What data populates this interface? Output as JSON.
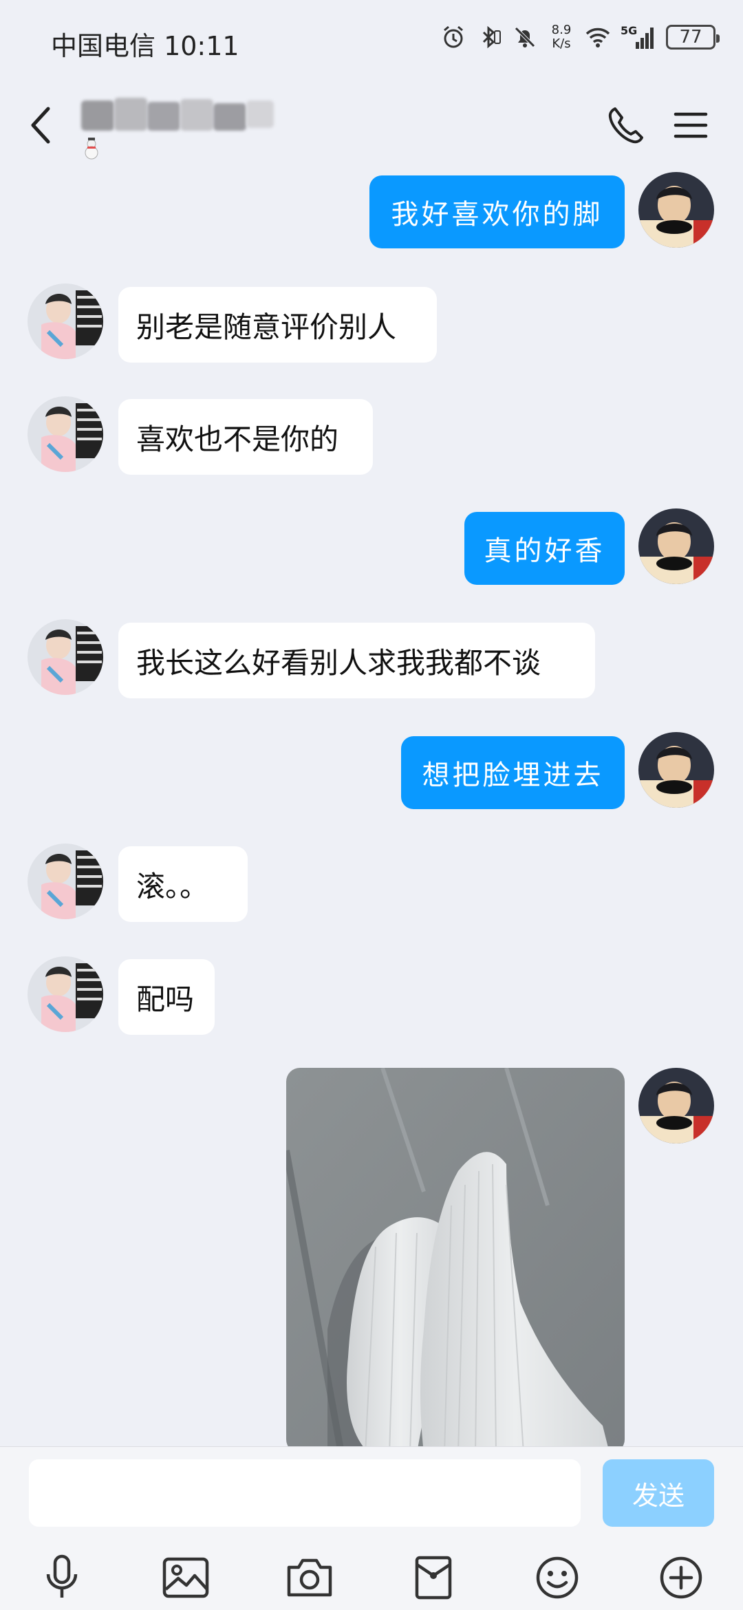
{
  "status_bar": {
    "carrier_time": "中国电信 10:11",
    "net_speed_value": "8.9",
    "net_speed_unit": "K/s",
    "network": "5G",
    "battery": "77"
  },
  "header": {
    "contact_name": "",
    "icons": [
      "back-arrow-icon",
      "phone-icon",
      "menu-icon"
    ]
  },
  "messages": [
    {
      "side": "out",
      "text": "我好喜欢你的脚"
    },
    {
      "side": "in",
      "text": "别老是随意评价别人"
    },
    {
      "side": "in",
      "text": "喜欢也不是你的"
    },
    {
      "side": "out",
      "text": "真的好香"
    },
    {
      "side": "in",
      "text": "我长这么好看别人求我我都不谈"
    },
    {
      "side": "out",
      "text": "想把脸埋进去"
    },
    {
      "side": "in",
      "text": "滚。。"
    },
    {
      "side": "in",
      "text": "配吗"
    },
    {
      "side": "out",
      "type": "image",
      "subject": "white-socks-photo"
    }
  ],
  "input_bar": {
    "placeholder": "",
    "send_label": "发送",
    "tools": [
      "microphone-icon",
      "image-icon",
      "camera-icon",
      "red-packet-icon",
      "emoji-icon",
      "plus-icon"
    ]
  },
  "colors": {
    "background": "#eef0f6",
    "outgoing_bubble": "#0a99ff",
    "incoming_bubble": "#ffffff",
    "send_button": "#8cd0ff"
  }
}
